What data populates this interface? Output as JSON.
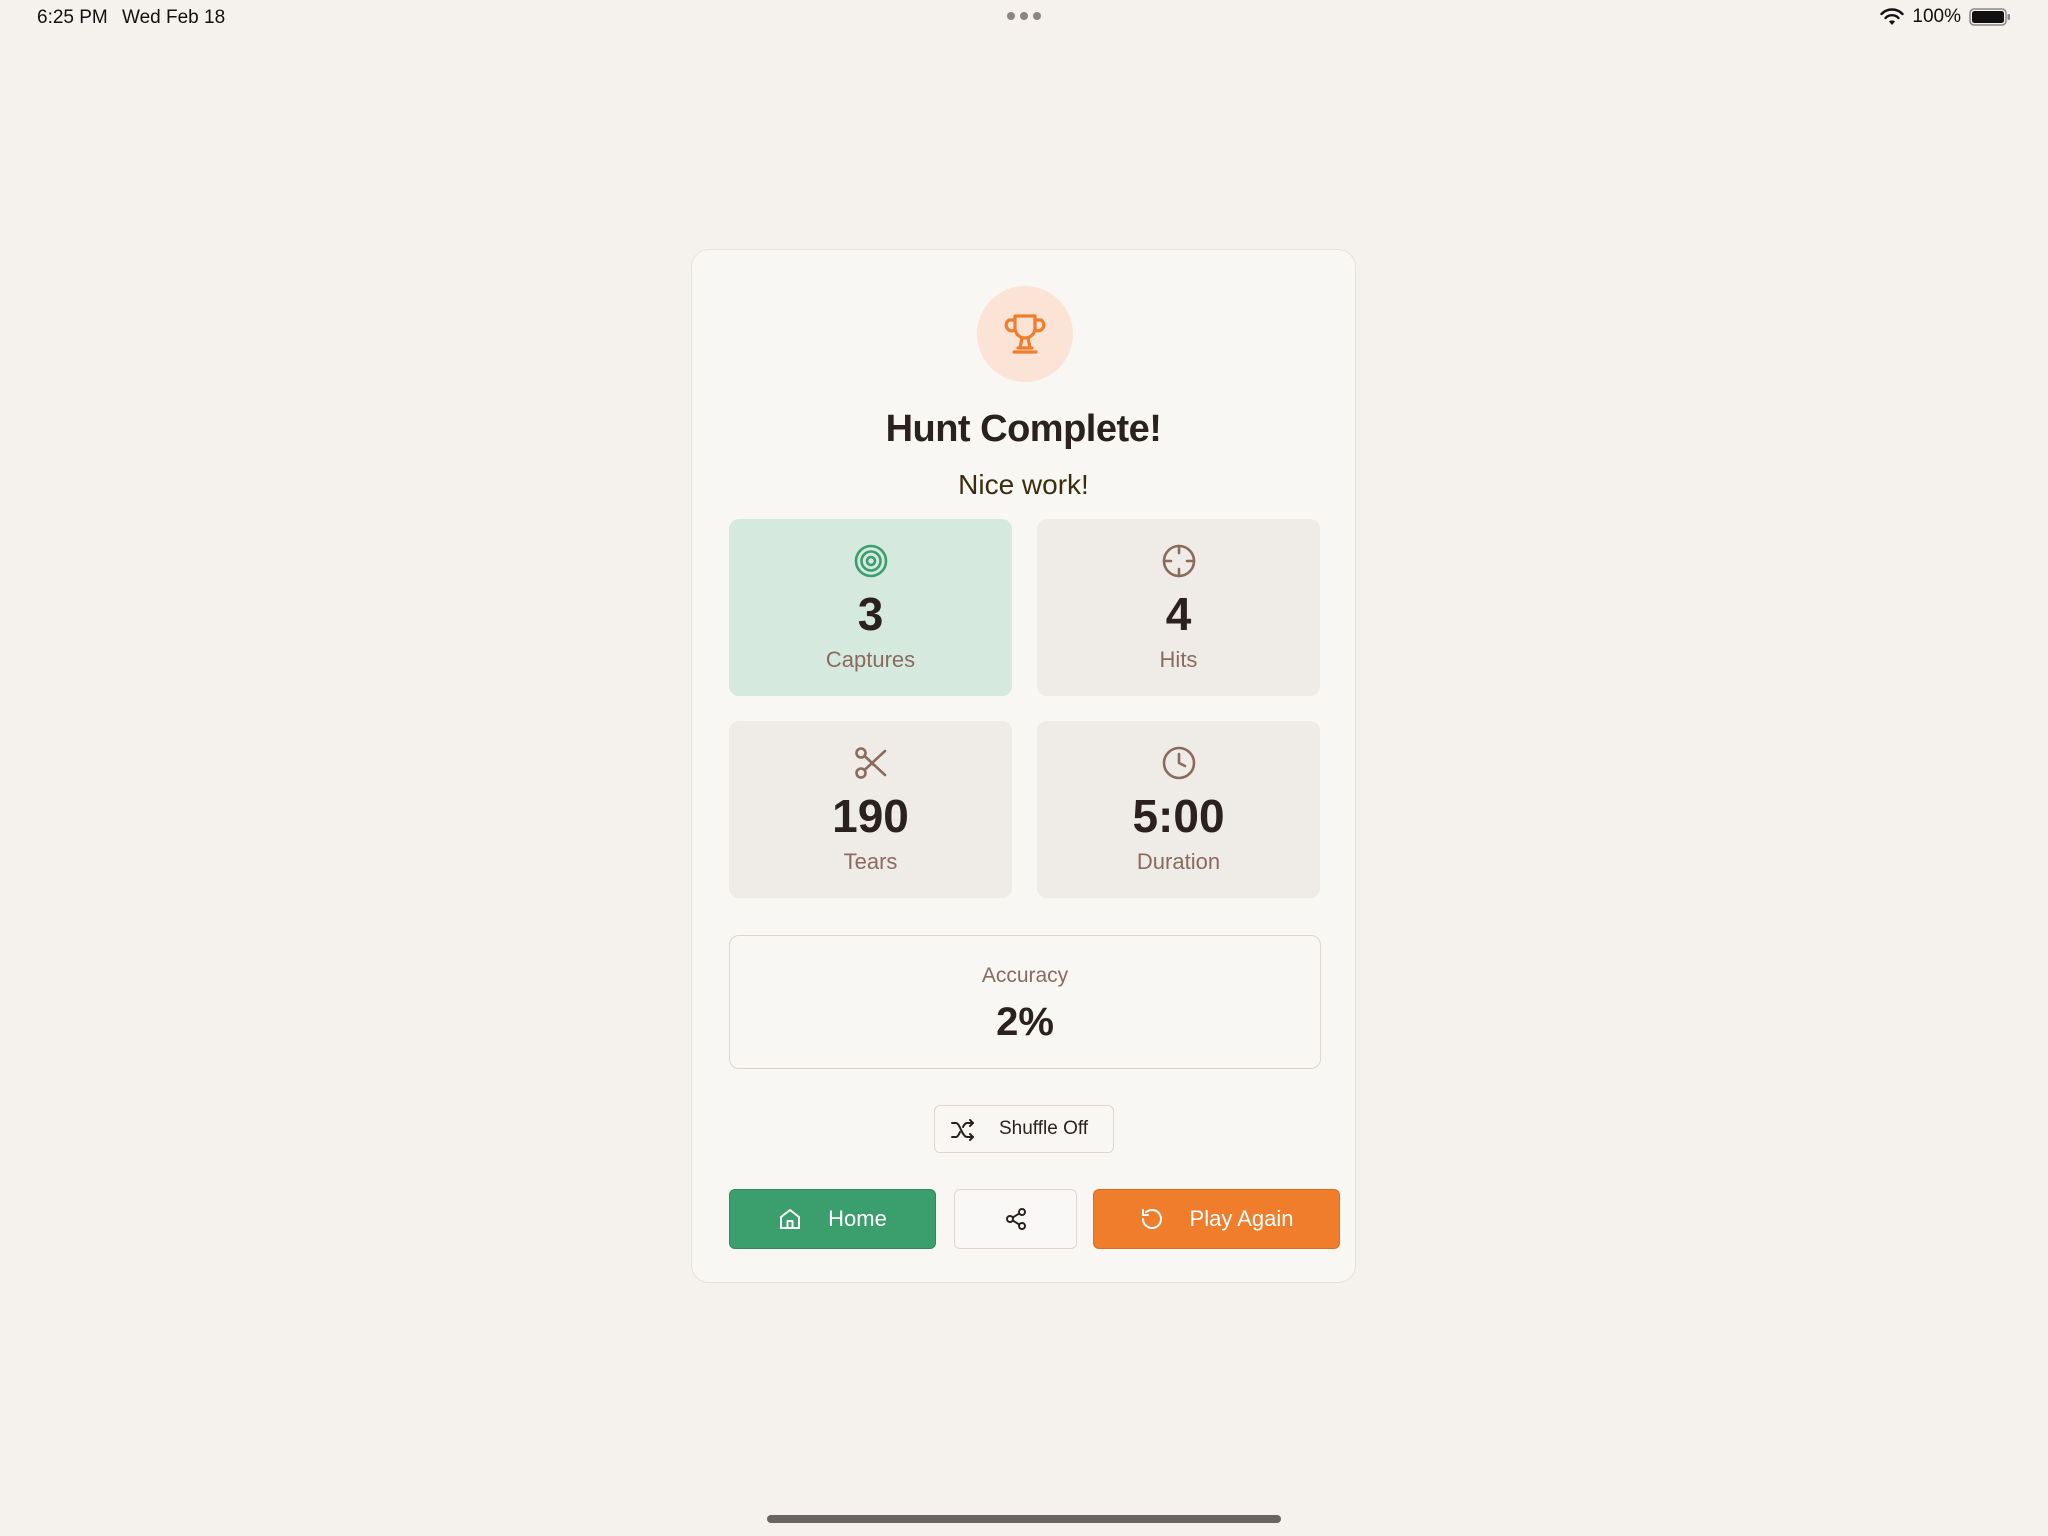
{
  "status_bar": {
    "time": "6:25 PM",
    "date": "Wed Feb 18",
    "battery": "100%"
  },
  "result": {
    "title": "Hunt Complete!",
    "subtitle": "Nice work!",
    "stats": [
      {
        "value": "3",
        "label": "Captures",
        "icon": "target-icon"
      },
      {
        "value": "4",
        "label": "Hits",
        "icon": "crosshair-icon"
      },
      {
        "value": "190",
        "label": "Tears",
        "icon": "scissors-icon"
      },
      {
        "value": "5:00",
        "label": "Duration",
        "icon": "clock-icon"
      }
    ],
    "accuracy": {
      "label": "Accuracy",
      "value": "2%"
    }
  },
  "controls": {
    "shuffle_label": "Shuffle Off",
    "home_label": "Home",
    "play_again_label": "Play Again"
  },
  "colors": {
    "background": "#f5f1ed",
    "accent_orange": "#ef7d2c",
    "accent_green": "#3a9e6d",
    "highlight_green": "#d6e9de"
  }
}
